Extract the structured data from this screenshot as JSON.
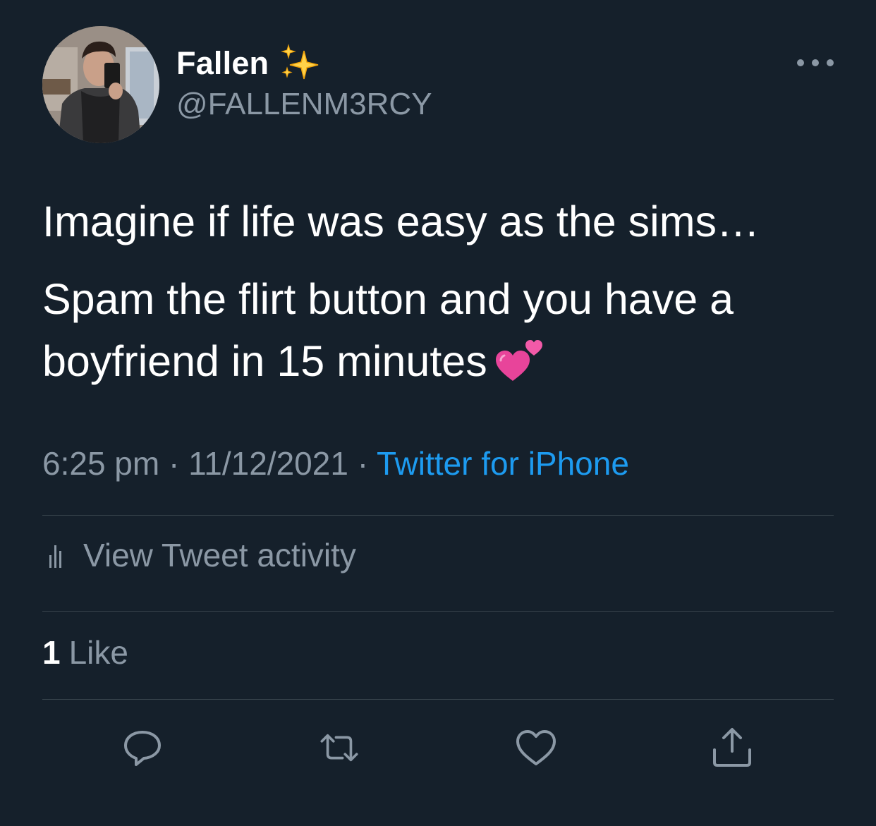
{
  "author": {
    "display_name": "Fallen",
    "name_emoji": "sparkles-icon",
    "handle": "@FALLENM3RCY"
  },
  "tweet": {
    "line_1": "Imagine if life was easy as the sims…",
    "line_2": "Spam the flirt button and you have a",
    "line_3": "boyfriend in 15 minutes",
    "line_3_emoji": "two-hearts-icon"
  },
  "meta": {
    "time": "6:25 pm",
    "separator_1": " · ",
    "date": "11/12/2021",
    "separator_2": " · ",
    "source": "Twitter for iPhone"
  },
  "activity": {
    "label": "View Tweet activity"
  },
  "likes": {
    "count": "1",
    "label": "Like"
  },
  "actions": {
    "reply": "reply-icon",
    "retweet": "retweet-icon",
    "like": "heart-icon",
    "share": "share-icon"
  },
  "colors": {
    "background": "#15202b",
    "text_primary": "#ffffff",
    "text_secondary": "#8b98a5",
    "link": "#1d9bf0",
    "divider": "#38444d"
  }
}
